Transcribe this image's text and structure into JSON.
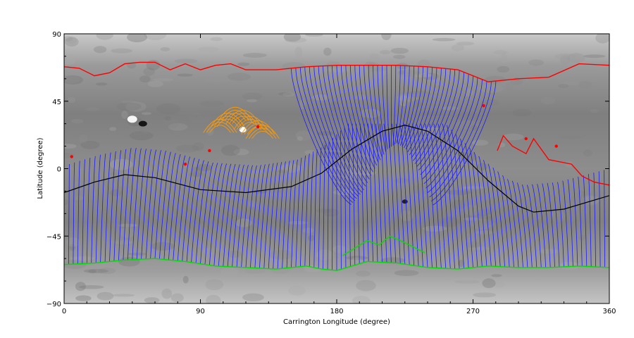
{
  "chart_data": {
    "type": "line",
    "xlabel": "Carrington Longitude (degree)",
    "ylabel": "Latitude (degree)",
    "xlim": [
      0,
      360
    ],
    "ylim": [
      -90,
      90
    ],
    "x_ticks": [
      0,
      90,
      180,
      270,
      360
    ],
    "y_ticks": [
      -90,
      -45,
      0,
      45,
      90
    ],
    "x_tick_labels": [
      "0",
      "90",
      "180",
      "270",
      "360"
    ],
    "y_tick_labels": [
      "−90",
      "−45",
      "0",
      "45",
      "90"
    ],
    "grid": false,
    "legend": "none",
    "colors": {
      "background_map": "#8c8c8c",
      "open_field_lines": "#1a1aff",
      "closed_field_lines": "#ff9900",
      "positive_boundary": "#ff0000",
      "negative_boundary": "#00dd00",
      "neutral_line": "#000000"
    },
    "neutral_line": {
      "x": [
        0,
        20,
        40,
        60,
        90,
        120,
        150,
        170,
        190,
        210,
        225,
        240,
        260,
        280,
        300,
        310,
        330,
        360
      ],
      "y": [
        -16,
        -9,
        -4,
        -6,
        -14,
        -16,
        -12,
        -3,
        13,
        25,
        29,
        25,
        12,
        -8,
        -25,
        -29,
        -27,
        -18
      ]
    },
    "positive_boundary_north": {
      "x": [
        0,
        10,
        20,
        30,
        40,
        50,
        60,
        70,
        80,
        90,
        100,
        110,
        120,
        130,
        140,
        160,
        180,
        200,
        220,
        240,
        260,
        280,
        300,
        320,
        340,
        360
      ],
      "y": [
        68,
        67,
        62,
        64,
        70,
        71,
        71,
        66,
        70,
        66,
        69,
        70,
        66,
        66,
        66,
        68,
        69,
        69,
        69,
        68,
        66,
        58,
        60,
        61,
        70,
        69
      ]
    },
    "negative_boundary_south": {
      "x": [
        0,
        20,
        40,
        60,
        80,
        100,
        120,
        140,
        160,
        170,
        180,
        200,
        220,
        240,
        260,
        280,
        300,
        320,
        340,
        360
      ],
      "y": [
        -64,
        -63,
        -61,
        -60,
        -62,
        -65,
        -66,
        -67,
        -65,
        -67,
        -68,
        -62,
        -63,
        -66,
        -67,
        -65,
        -66,
        -66,
        -65,
        -66
      ]
    },
    "positive_boundary_east": {
      "x": [
        286,
        290,
        296,
        305,
        310,
        320,
        335,
        342,
        350,
        360
      ],
      "y": [
        12,
        22,
        15,
        10,
        20,
        6,
        3,
        -5,
        -9,
        -11
      ]
    },
    "negative_boundary_center": {
      "x": [
        184,
        192,
        200,
        208,
        215,
        222,
        230,
        238
      ],
      "y": [
        -58,
        -53,
        -48,
        -51,
        -45,
        -48,
        -52,
        -56
      ]
    },
    "closed_loop_region": {
      "x": [
        100,
        105,
        110,
        115,
        120,
        125,
        128
      ],
      "y": [
        28,
        32,
        36,
        34,
        30,
        27,
        24
      ]
    }
  }
}
